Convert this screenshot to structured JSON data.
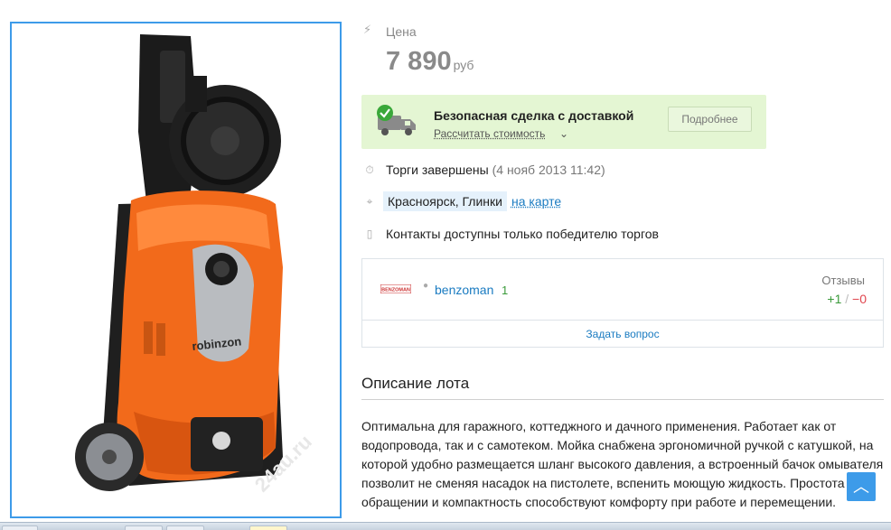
{
  "photo": {
    "alt": "robinzon",
    "brand_text": "robinzon",
    "watermark": "24au.ru"
  },
  "price": {
    "label": "Цена",
    "value": "7 890",
    "currency": "руб"
  },
  "deal": {
    "title": "Безопасная сделка с доставкой",
    "calc_link": "Рассчитать стоимость",
    "more_button": "Подробнее"
  },
  "auction": {
    "status": "Торги завершены",
    "date": "(4 нояб 2013 11:42)"
  },
  "location": {
    "place": "Красноярск, Глинки",
    "map_link": "на карте"
  },
  "contacts": {
    "text": "Контакты доступны только победителю торгов"
  },
  "seller": {
    "logo_text": "BENZOMAN",
    "name": "benzoman",
    "rating": "1",
    "reviews_label": "Отзывы",
    "reviews_positive": "+1",
    "reviews_separator": "/",
    "reviews_negative": "−0",
    "ask_question": "Задать вопрос"
  },
  "description": {
    "title": "Описание лота",
    "text": "Оптимальна для гаражного, коттеджного и дачного применения. Работает как от водопровода, так и с самотеком. Мойка снабжена эргономичной ручкой с катушкой, на которой удобно размещается шланг высокого давления, а встроенный бачок омывателя позволит не сменяя насадок на пистолете, вспенить моющую жидкость. Простота в обращении и компактность способствуют комфорту при работе и перемещении."
  },
  "colors": {
    "accent_blue": "#3d9be9",
    "link_blue": "#1a7bc1",
    "deal_bg": "#e4f6d3",
    "positive": "#3a9a3a",
    "negative": "#e0454e",
    "product_orange": "#f26a1b"
  }
}
